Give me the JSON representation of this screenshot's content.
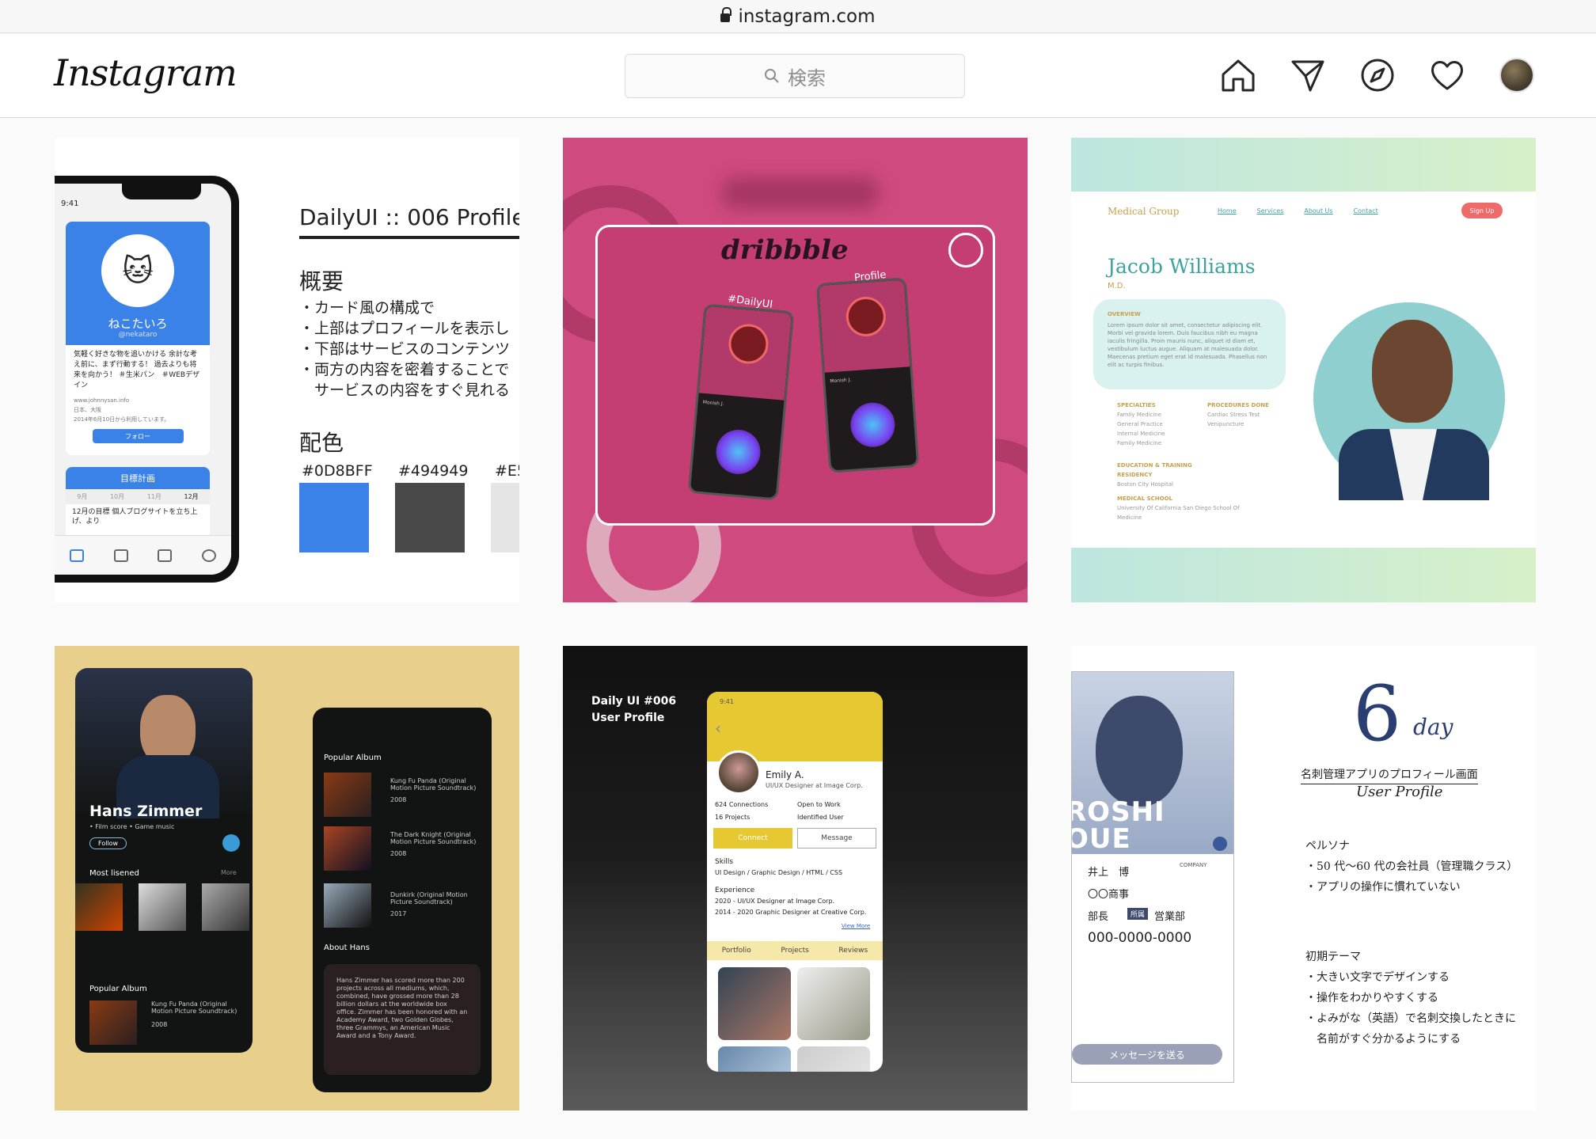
{
  "browser": {
    "url": "instagram.com"
  },
  "header": {
    "logo": "Instagram",
    "search_placeholder": "検索",
    "icons": [
      "home-icon",
      "direct-icon",
      "explore-icon",
      "activity-heart-icon",
      "profile-avatar"
    ]
  },
  "posts": {
    "p1": {
      "title": "DailyUI :: 006 Profile",
      "section_overview": "概要",
      "overview_items": [
        "・カード風の構成で",
        "・上部はプロフィールを表示し",
        "・下部はサービスのコンテンツ",
        "・両方の内容を密着することで",
        "　サービスの内容をすぐ見れる"
      ],
      "section_colors": "配色",
      "colors": [
        {
          "code": "#0D8BFF",
          "hex": "#3b82e8"
        },
        {
          "code": "#494949",
          "hex": "#494949"
        },
        {
          "code": "#E5",
          "hex": "#e5e5e5"
        }
      ],
      "phone": {
        "time": "9:41",
        "name": "ねこたいろ",
        "handle": "@nekataro",
        "bio": "気軽く好きな物を追いかける 余計な考え前に、まず行動する！ 過去よりも将来を向かう！ ＃生米パン　＃WEBデザイン",
        "site": "www.johnnysan.info",
        "location": "日本、大阪",
        "joined": "2014年6月10日から利用しています。",
        "follow": "フォロー",
        "goal_title": "目標計画",
        "months": [
          "9月",
          "10月",
          "11月",
          "12月"
        ],
        "goal_text": "12月の目標 個人ブログサイトを立ち上げ、より"
      }
    },
    "p2": {
      "brand": "dribbble",
      "label_left": "#DailyUI",
      "label_right": "Profile",
      "name": "Monish J."
    },
    "p3": {
      "brand": "Medical Group",
      "nav": [
        "Home",
        "Services",
        "About Us",
        "Contact"
      ],
      "signup": "Sign Up",
      "name": "Jacob Williams",
      "title": "M.D.",
      "overview_label": "OVERVIEW",
      "overview_text": "Lorem ipsum dolor sit amet, consectetur adipiscing elit. Morbi vel gravida lorem. Duis faucibus nibh eu magna iaculis fringilla. Proin mauris nunc, aliquet id diam et, vestibulum luctus augue. Aliquam at malesuada dolor. Maecenas pretium eget erat id malesuada. Phasellus non elit ac turpis finibus.",
      "specialties_label": "SPECIALTIES",
      "specialties": [
        "Family Medicine",
        "General Practice",
        "Internal Medicine",
        "Family Medicine"
      ],
      "procedures_label": "PROCEDURES DONE",
      "procedures": [
        "Cardiac Stress Test",
        "Venipuncture"
      ],
      "education_label": "EDUCATION & TRAINING",
      "residency_label": "RESIDENCY",
      "residency": "Boston City Hospital",
      "school_label": "MEDICAL SCHOOL",
      "school": "University Of California San Diego School Of Medicine"
    },
    "p4": {
      "artist": "Hans Zimmer",
      "tags": "• Film score   • Game music",
      "follow": "Follow",
      "most_listened": "Most lisened",
      "more": "More",
      "popular_album": "Popular Album",
      "album1": "Kung Fu Panda (Original Motion Picture Soundtrack)",
      "album1_year": "2008",
      "album2": "The Dark Knight (Original Motion Picture Soundtrack)",
      "album2_year": "2008",
      "album3": "Dunkirk (Original Motion Picture Soundtrack)",
      "album3_year": "2017",
      "about": "About Hans",
      "about_text": "Hans Zimmer has scored more than 200 projects across all mediums, which, combined, have grossed more than 28 billion dollars at the worldwide box office. Zimmer has been honored with an Academy Award, two Golden Globes, three Grammys, an American Music Award and a Tony Award."
    },
    "p5": {
      "heading_1": "Daily UI #006",
      "heading_2": "User Profile",
      "time": "9:41",
      "name": "Emily A.",
      "role": "UI/UX Designer at Image Corp.",
      "connections": "624 Connections",
      "projects": "16 Projects",
      "open": "Open to Work",
      "identified": "Identified User",
      "connect": "Connect",
      "message": "Message",
      "skills_label": "Skills",
      "skills": "UI Design / Graphic Design / HTML / CSS",
      "exp_label": "Experience",
      "exp1": "2020 -  UI/UX Designer at Image Corp.",
      "exp2": "2014 - 2020 Graphic Designer at Creative Corp.",
      "view_more": "View More",
      "tabs": [
        "Portfolio",
        "Projects",
        "Reviews"
      ]
    },
    "p6": {
      "big_name": "ROSHI\nOUE",
      "name": "井上　博",
      "company": "〇〇商事",
      "position": "部長",
      "dept_tag": "所属",
      "dept": "営業部",
      "phone": "000-0000-0000",
      "company_label": "COMPANY",
      "button": "メッセージを送る",
      "six": "6",
      "day": "day",
      "subtitle": "名刺管理アプリのプロフィール画面",
      "user_profile": "User Profile",
      "persona_label": "ペルソナ",
      "persona": [
        "・50 代〜60 代の会社員（管理職クラス）",
        "・アプリの操作に慣れていない"
      ],
      "theme_label": "初期テーマ",
      "theme": [
        "・大きい文字でデザインする",
        "・操作をわかりやすくする",
        "・よみがな（英語）で名刺交換したときに",
        "　名前がすぐ分かるようにする"
      ]
    }
  }
}
